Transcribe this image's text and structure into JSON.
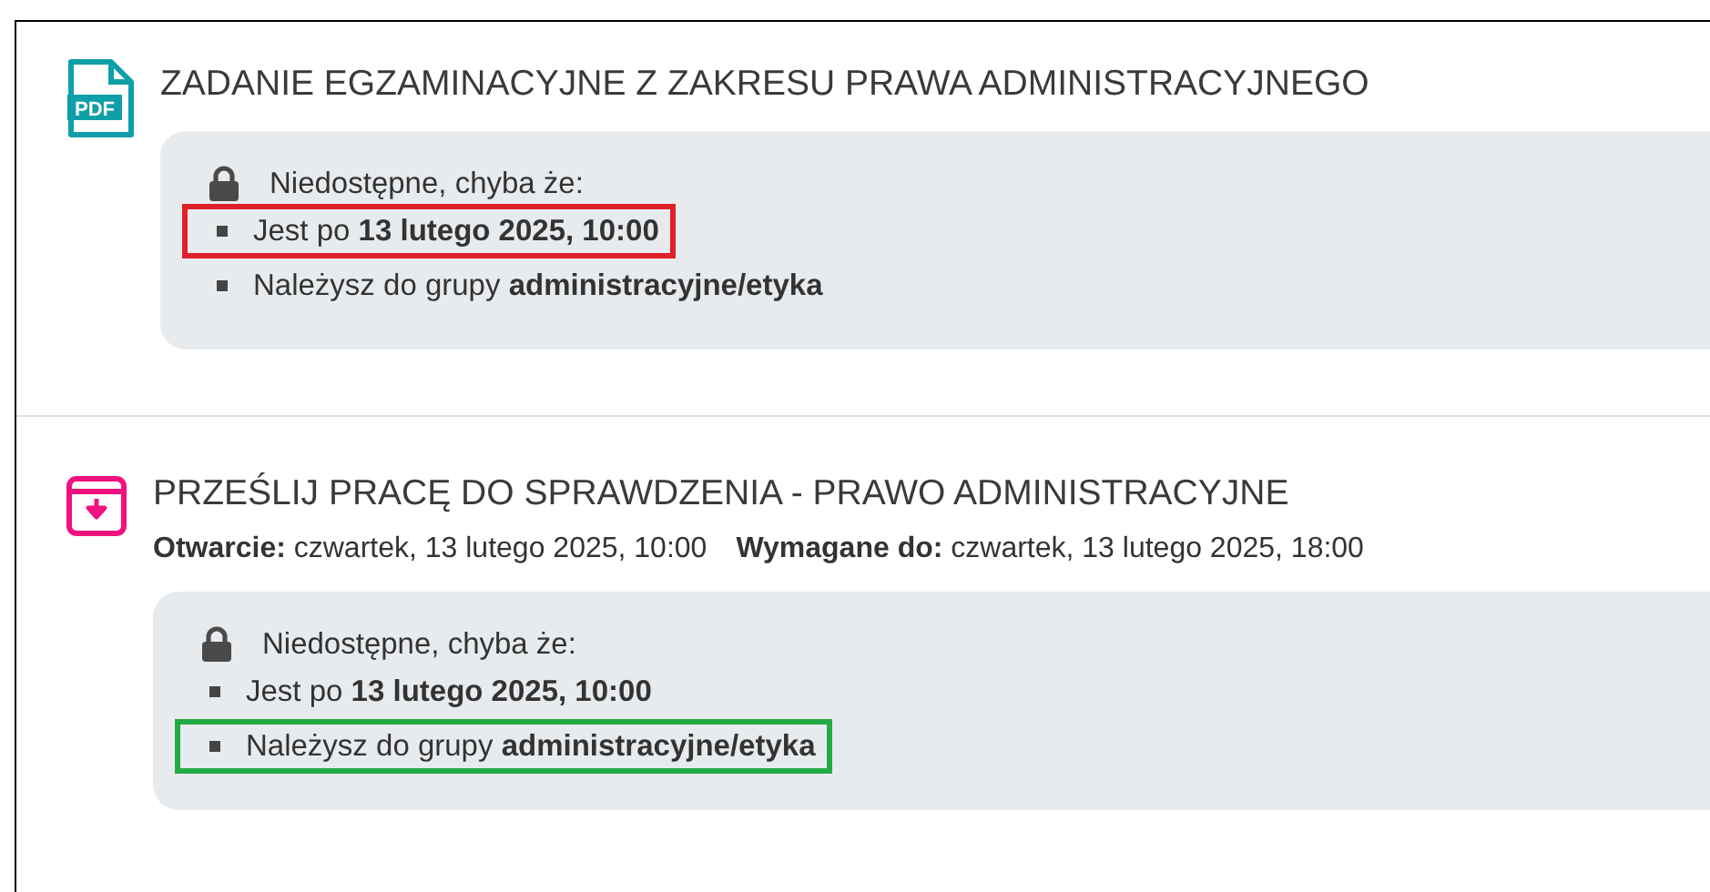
{
  "activities": [
    {
      "kind": "pdf",
      "icon_label": "PDF",
      "title": "ZADANIE EGZAMINACYJNE Z ZAKRESU PRAWA ADMINISTRACYJNEGO",
      "restriction": {
        "heading": "Niedostępne, chyba że:",
        "conditions": [
          {
            "text": "Jest po **13 lutego 2025, 10:00**",
            "color": "#e0202a"
          },
          {
            "text": "Należysz do grupy **administracyjne/etyka**"
          }
        ]
      }
    },
    {
      "kind": "assignment",
      "title": "PRZEŚLIJ PRACĘ DO SPRAWDZENIA - PRAWO ADMINISTRACYJNE",
      "dates": [
        {
          "label": "Otwarcie:",
          "value": "czwartek, 13 lutego 2025, 10:00"
        },
        {
          "label": "Wymagane do:",
          "value": "czwartek, 13 lutego 2025, 18:00"
        }
      ],
      "restriction": {
        "heading": "Niedostępne, chyba że:",
        "conditions": [
          {
            "text": "Jest po **13 lutego 2025, 10:00**"
          },
          {
            "text": "Należysz do grupy **administracyjne/etyka**",
            "color": "#22aa44"
          }
        ]
      }
    }
  ]
}
